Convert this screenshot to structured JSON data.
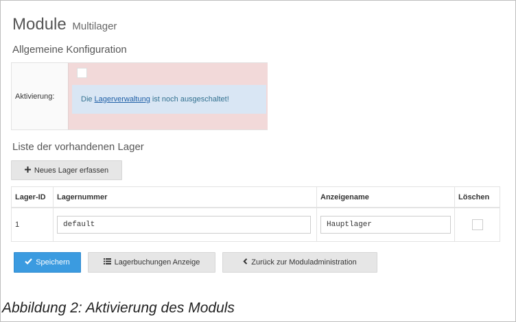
{
  "page": {
    "title": "Module",
    "subtitle": "Multilager",
    "section_general": "Allgemeine Konfiguration",
    "section_list": "Liste der vorhandenen Lager",
    "caption": "Abbildung 2: Aktivierung des Moduls"
  },
  "config": {
    "activation_label": "Aktivierung:",
    "alert_prefix": "Die",
    "alert_link": "Lagerverwaltung",
    "alert_suffix": "ist noch ausgeschaltet!"
  },
  "buttons": {
    "new_storage": "Neues Lager erfassen",
    "save": "Speichern",
    "bookings": "Lagerbuchungen Anzeige",
    "back": "Zurück zur Moduladministration"
  },
  "table": {
    "headers": [
      "Lager-ID",
      "Lagernummer",
      "Anzeigename",
      "Löschen"
    ],
    "rows": [
      {
        "id": "1",
        "number": "default",
        "display_name": "Hauptlager"
      }
    ]
  },
  "icons": {
    "plus": "plus-icon",
    "check": "check-icon",
    "list": "list-icon",
    "chevron_left": "chevron-left-icon"
  },
  "colors": {
    "primary": "#3b9be0",
    "danger_bg": "#f2d9d9",
    "info_bg": "#d9e6f4"
  }
}
